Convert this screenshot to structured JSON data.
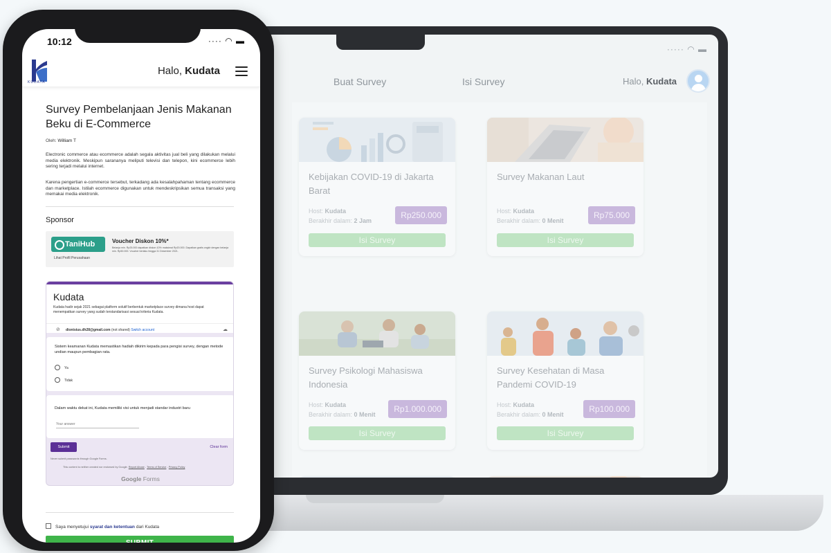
{
  "laptop": {
    "nav": {
      "buat_survey": "Buat Survey",
      "isi_survey": "Isi Survey",
      "greeting_prefix": "Halo, ",
      "greeting_name": "Kudata"
    },
    "cards": [
      {
        "title": "Kebijakan COVID-19 di Jakarta Barat",
        "host_label": "Host: ",
        "host": "Kudata",
        "ends_label": "Berakhir dalam: ",
        "ends": "2 Jam",
        "price": "Rp250.000",
        "button": "Isi Survey"
      },
      {
        "title": "Survey Makanan Laut",
        "host_label": "Host: ",
        "host": "Kudata",
        "ends_label": "Berakhir dalam: ",
        "ends": "0 Menit",
        "price": "Rp75.000",
        "button": "Isi Survey"
      },
      {
        "title": "Survey Psikologi Mahasiswa Indonesia",
        "host_label": "Host: ",
        "host": "Kudata",
        "ends_label": "Berakhir dalam: ",
        "ends": "0 Menit",
        "price": "Rp1.000.000",
        "button": "Isi Survey"
      },
      {
        "title": "Survey Kesehatan di Masa Pandemi COVID-19",
        "host_label": "Host: ",
        "host": "Kudata",
        "ends_label": "Berakhir dalam: ",
        "ends": "0 Menit",
        "price": "Rp100.000",
        "button": "Isi Survey"
      }
    ]
  },
  "phone": {
    "time": "10:12",
    "header": {
      "greeting_prefix": "Halo, ",
      "greeting_name": "Kudata",
      "logo_text": "KUDATA"
    },
    "survey": {
      "title": "Survey Pembelanjaan Jenis Makanan Beku di E-Commerce",
      "author_label": "Oleh: ",
      "author": "William T",
      "paragraph_1": "Electronic commerce atau ecommerce adalah segala aktivitas jual beli yang dilakukan melalui media elektronik. Meskipun sarananya meliputi televisi dan telepon, kini ecommerce lebih sering terjadi melalui internet.",
      "paragraph_2": "Karena pengertian e-commerce tersebut, terkadang ada kesalahpahaman tentang ecommerce dan marketplace. Istilah ecommerce digunakan untuk mendeskripsikan semua transaksi yang memakai media elektronik."
    },
    "sponsor": {
      "label": "Sponsor",
      "company": "TaniHub",
      "profile_link": "Lihat Profil Perusahaan",
      "voucher_title": "Voucher Diskon 10%*",
      "voucher_desc": "Belanja min. Rp25.000 dapatkan diskon 10% maksimal Rp20.000. Dapatkan gratis ongkir dengan belanja min. Rp50.000. Voucher berlaku hingga 31 Desember 2021."
    },
    "gform": {
      "title": "Kudata",
      "description": "Kudata hadir sejak 2021 sebagai platform solutif berbentuk marketplace survey dimana host dapat menempatkan survey yang sudah terstandarisasi sesuai kriteria Kudata.",
      "email": "dionisius.dh28@gmail.com",
      "not_shared": " (not shared) ",
      "switch_account": "Switch account",
      "q1": "Sistem keamanan Kudata memastikan hadiah dikirim kepada para pengisi survey, dengan metode undian maupun pembagian rata.",
      "q1_options": [
        "Ya",
        "Tidak"
      ],
      "q2": "Dalam waktu dekat ini, Kudata memiliki visi untuk menjadi standar industri baru",
      "answer_placeholder": "Your answer",
      "submit": "Submit",
      "clear": "Clear form",
      "never": "Never submit passwords through Google Forms.",
      "note_text": "This content is neither created nor endorsed by Google. ",
      "report_abuse": "Report Abuse",
      "terms": "Terms of Service",
      "privacy": "Privacy Policy",
      "logo_google": "Google",
      "logo_forms": " Forms"
    },
    "agree": {
      "prefix": "Saya menyetujui ",
      "link": "syarat dan ketentuan",
      "suffix": " dari Kudata"
    },
    "submit_label": "SUBMIT"
  },
  "colors": {
    "accent_purple": "#5b2f96",
    "submit_green": "#3fb44a",
    "brand_blue": "#2b3a8f"
  }
}
